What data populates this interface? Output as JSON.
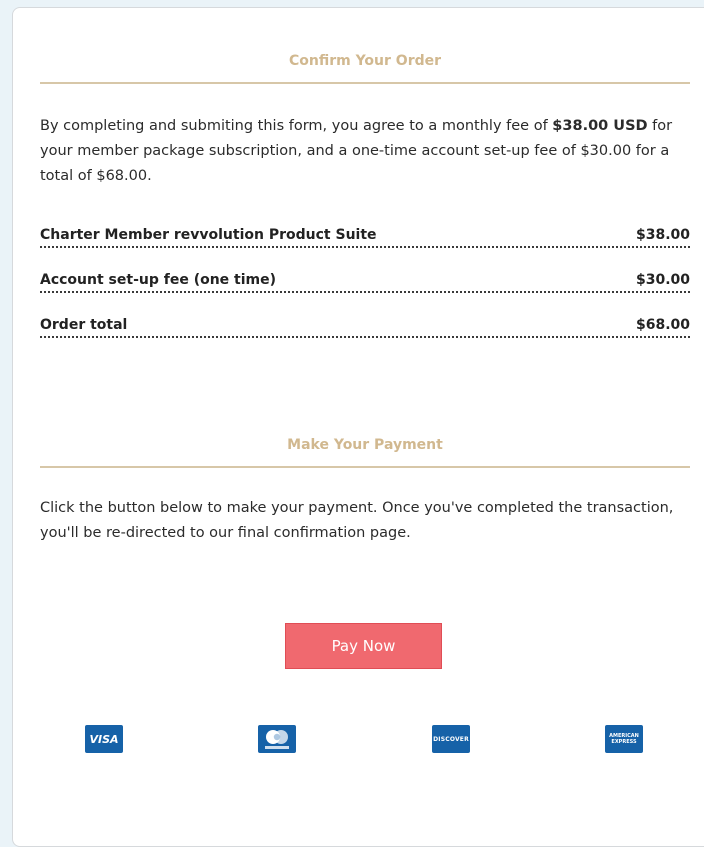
{
  "confirm": {
    "title": "Confirm Your Order",
    "agreement_pre": "By completing and submiting this form, you agree to a monthly fee of ",
    "agreement_bold": "$38.00 USD",
    "agreement_post": " for your member package subscription, and a one-time account set-up fee of $30.00 for a total of $68.00.",
    "items": [
      {
        "label": "Charter Member revvolution Product Suite",
        "amount": "$38.00"
      },
      {
        "label": "Account set-up fee (one time)",
        "amount": "$30.00"
      },
      {
        "label": "Order total",
        "amount": "$68.00"
      }
    ]
  },
  "payment": {
    "title": "Make Your Payment",
    "instructions": "Click the button below to make your payment. Once you've completed the transaction, you'll be re-directed to our final confirmation page.",
    "button_label": "Pay Now"
  },
  "cards": [
    {
      "name": "visa-icon",
      "text": "VISA"
    },
    {
      "name": "mastercard-icon",
      "text": "mastercard"
    },
    {
      "name": "discover-icon",
      "text": "DISCOVER"
    },
    {
      "name": "amex-icon",
      "text": "AMERICAN EXPRESS"
    }
  ],
  "colors": {
    "accent_gold": "#d1b88f",
    "button_red": "#f0696f",
    "card_blue": "#1662a8"
  }
}
